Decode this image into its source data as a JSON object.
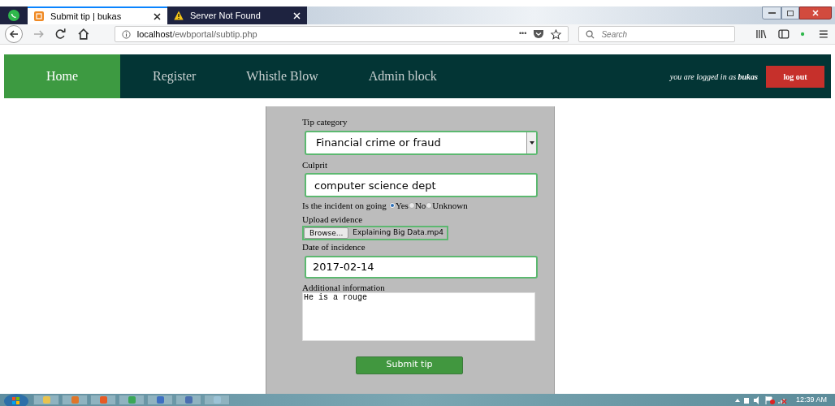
{
  "browser": {
    "tabs": [
      {
        "title": "Submit tip | bukas",
        "selected": true,
        "kind": "page"
      },
      {
        "title": "Server Not Found",
        "selected": false,
        "kind": "warning"
      }
    ],
    "url_host": "localhost",
    "url_path": "/ewbportal/subtip.php",
    "search": {
      "placeholder": "Search"
    },
    "more": "•••"
  },
  "nav": {
    "items": [
      {
        "label": "Home",
        "selected": true
      },
      {
        "label": "Register",
        "selected": false
      },
      {
        "label": "Whistle Blow",
        "selected": false
      },
      {
        "label": "Admin block",
        "selected": false
      }
    ],
    "login_text": "you are logged in as **bukas**",
    "logout": "log out"
  },
  "form": {
    "tip_category_label": "Tip category",
    "tip_category": "Financial crime or fraud",
    "culprit_label": "Culprit",
    "culprit": "computer science dept",
    "ongoing_label": "Is the incident on going",
    "ongoing_options": [
      {
        "label": "Yes",
        "selected": true
      },
      {
        "label": "No",
        "selected": false
      },
      {
        "label": "Unknown",
        "selected": false
      }
    ],
    "upload_label": "Upload evidence",
    "browse": "Browse...",
    "file_name": "Explaining Big Data.mp4",
    "date_label": "Date of incidence",
    "date": "2017-02-14",
    "info_label": "Additional information",
    "info": "He is a rouge",
    "submit": "Submit tip"
  },
  "taskbar": {
    "time": "12:39 AM"
  }
}
